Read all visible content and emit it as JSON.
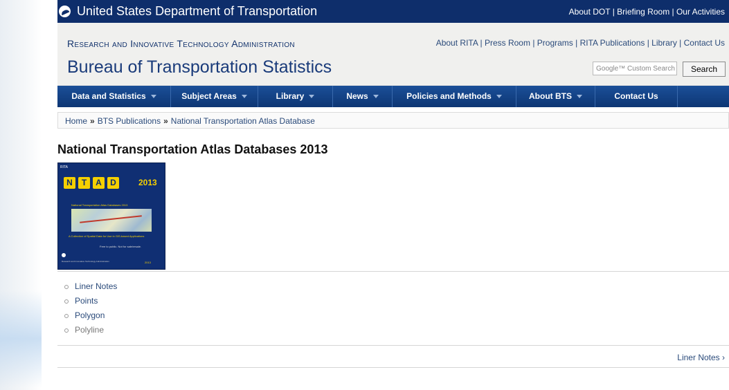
{
  "dot": {
    "title": "United States Department of Transportation",
    "links": "About DOT | Briefing Room | Our Activities"
  },
  "header": {
    "rita": "Research and Innovative Technology Administration",
    "bts": "Bureau of Transportation Statistics",
    "rita_links": "About RITA | Press Room | Programs | RITA Publications | Library | Contact Us",
    "search_placeholder": "Google™ Custom Search",
    "search_button": "Search"
  },
  "nav": {
    "items": [
      {
        "label": "Data and Statistics",
        "dropdown": true
      },
      {
        "label": "Subject Areas",
        "dropdown": true
      },
      {
        "label": "Library",
        "dropdown": true
      },
      {
        "label": "News",
        "dropdown": true
      },
      {
        "label": "Policies and Methods",
        "dropdown": true
      },
      {
        "label": "About BTS",
        "dropdown": true
      },
      {
        "label": "Contact Us",
        "dropdown": false
      }
    ]
  },
  "breadcrumb": {
    "items": [
      "Home",
      "BTS Publications",
      "National Transportation Atlas Database"
    ],
    "separator": "»"
  },
  "page": {
    "title": "National Transportation Atlas Databases 2013"
  },
  "cover": {
    "tag": "RITA",
    "letters": [
      "N",
      "T",
      "A",
      "D"
    ],
    "year": "2013",
    "subtitle": "National Transportation Atlas Databases 2013",
    "collection": "A Collection of Spatial Data for Use in GIS-based Applications",
    "free": "Free to public. Not for sale/resale.",
    "footer": "Research and Innovative Technology Administration",
    "footer_year": "2013"
  },
  "links": [
    {
      "label": "Liner Notes",
      "dim": false
    },
    {
      "label": "Points",
      "dim": false
    },
    {
      "label": "Polygon",
      "dim": false
    },
    {
      "label": "Polyline",
      "dim": true
    }
  ],
  "next": "Liner Notes ›",
  "colors": {
    "dot_bar": "#0e2e6b",
    "nav": "#0f3c80",
    "link": "#2a4a7a",
    "ntad_yellow": "#f5d000"
  }
}
